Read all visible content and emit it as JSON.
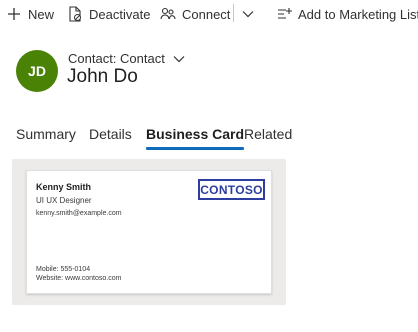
{
  "toolbar": {
    "new_label": "New",
    "deactivate_label": "Deactivate",
    "connect_label": "Connect",
    "add_marketing_label": "Add to Marketing List"
  },
  "header": {
    "avatar_initials": "JD",
    "avatar_color": "#498205",
    "entity_label": "Contact: Contact",
    "record_name": "John Do"
  },
  "tabs": [
    {
      "label": "Summary"
    },
    {
      "label": "Details"
    },
    {
      "label": "Business Card",
      "selected": true
    },
    {
      "label": "Related"
    }
  ],
  "business_card": {
    "name": "Kenny Smith",
    "title": "UI UX Designer",
    "email": "kenny.smith@example.com",
    "logo_text": "CONTOSO",
    "logo_color": "#2b3d9f",
    "mobile": "Mobile: 555-0104",
    "website": "Website: www.contoso.com"
  },
  "accent_color": "#0f6cbd"
}
